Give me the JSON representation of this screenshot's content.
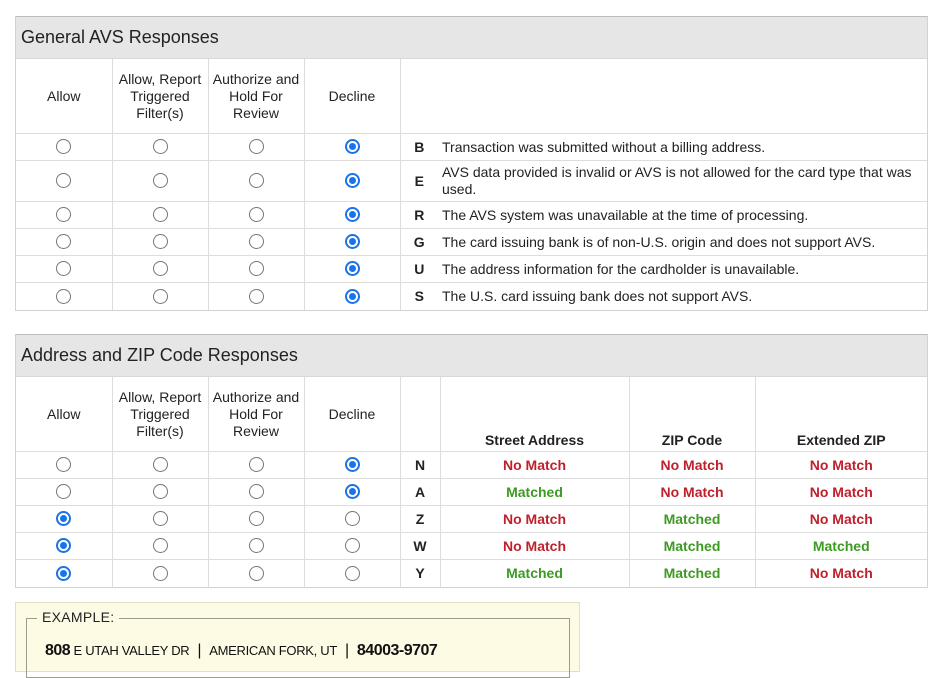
{
  "option_headers": {
    "allow": "Allow",
    "allow_report": "Allow, Report Triggered Filter(s)",
    "authorize_hold": "Authorize and Hold For Review",
    "decline": "Decline"
  },
  "avs": {
    "title": "General AVS Responses",
    "rows": [
      {
        "code": "B",
        "description": "Transaction was submitted without a billing address.",
        "selected": "decline"
      },
      {
        "code": "E",
        "description": "AVS data provided is invalid or AVS is not allowed for the card type that was used.",
        "selected": "decline"
      },
      {
        "code": "R",
        "description": "The AVS system was unavailable at the time of processing.",
        "selected": "decline"
      },
      {
        "code": "G",
        "description": "The card issuing bank is of non-U.S. origin and does not support AVS.",
        "selected": "decline"
      },
      {
        "code": "U",
        "description": "The address information for the cardholder is unavailable.",
        "selected": "decline"
      },
      {
        "code": "S",
        "description": "The U.S. card issuing bank does not support AVS.",
        "selected": "decline"
      }
    ]
  },
  "zip": {
    "title": "Address and ZIP Code Responses",
    "columns": {
      "street": "Street Address",
      "zip": "ZIP Code",
      "extended": "Extended ZIP"
    },
    "rows": [
      {
        "code": "N",
        "street": "No Match",
        "zip": "No Match",
        "extended": "No Match",
        "selected": "decline"
      },
      {
        "code": "A",
        "street": "Matched",
        "zip": "No Match",
        "extended": "No Match",
        "selected": "decline"
      },
      {
        "code": "Z",
        "street": "No Match",
        "zip": "Matched",
        "extended": "No Match",
        "selected": "allow"
      },
      {
        "code": "W",
        "street": "No Match",
        "zip": "Matched",
        "extended": "Matched",
        "selected": "allow"
      },
      {
        "code": "Y",
        "street": "Matched",
        "zip": "Matched",
        "extended": "No Match",
        "selected": "allow"
      }
    ]
  },
  "example": {
    "legend": "EXAMPLE:",
    "street_number": "808",
    "street_name": "E UTAH VALLEY DR",
    "separator": "|",
    "city_state": "AMERICAN FORK, UT",
    "zip": "84003-9707"
  },
  "colors": {
    "matched": "#3d9a23",
    "no_match": "#c0202b",
    "radio_selected": "#1a73e8",
    "header_bg": "#e6e6e6",
    "example_bg": "#fdfbe3"
  }
}
